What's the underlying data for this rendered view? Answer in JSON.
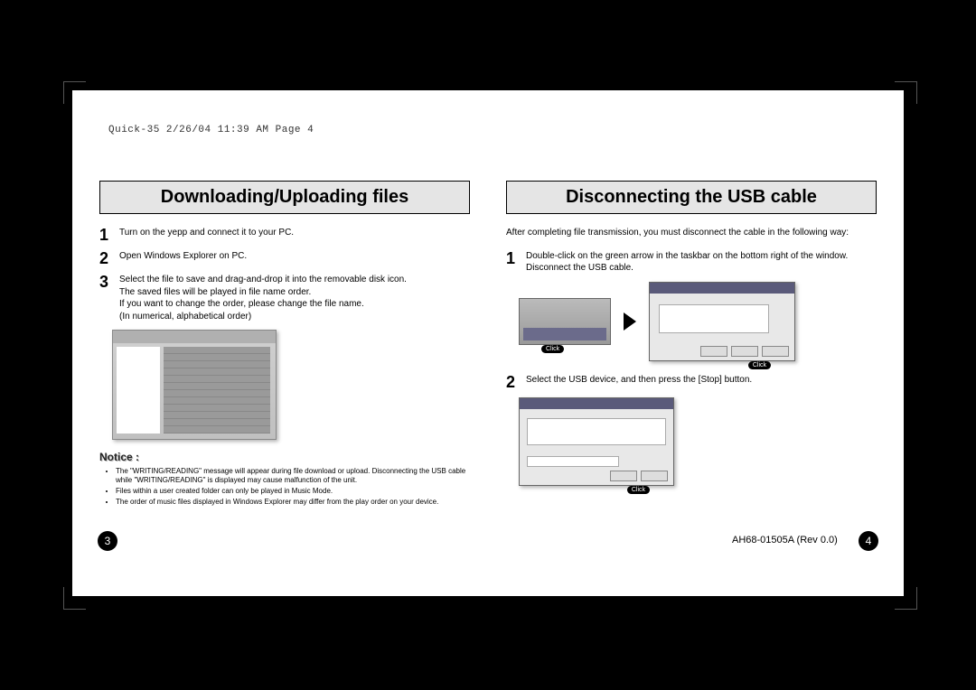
{
  "print": {
    "footer": "Quick-35  2/26/04  11:39 AM  Page 4"
  },
  "left": {
    "title": "Downloading/Uploading files",
    "steps": [
      "Turn on the yepp and connect it to your PC.",
      "Open Windows Explorer on PC.",
      "Select the file to save and drag-and-drop it into the removable disk icon.\nThe saved files will be played in file name order.\nIf you want to change the order, please change the file name.\n(In numerical, alphabetical order)"
    ],
    "notice_title": "Notice :",
    "notice": [
      "The \"WRITING/READING\" message will appear during file download or upload. Disconnecting the USB cable while \"WRITING/READING\" is displayed may cause malfunction of the unit.",
      "Files within a user created folder can only be played in Music Mode.",
      "The order of music files displayed in Windows Explorer may differ from the play order on your device."
    ]
  },
  "right": {
    "title": "Disconnecting the USB cable",
    "intro": "After completing file transmission, you must disconnect the cable in the following way:",
    "steps": [
      "Double-click on the green arrow in the taskbar on the bottom right of the window. Disconnect the USB cable.",
      "Select the USB device, and then press the [Stop] button."
    ],
    "click_label": "Click"
  },
  "pagination": {
    "left_page": "3",
    "right_page": "4",
    "doc_rev": "AH68-01505A (Rev  0.0)"
  }
}
